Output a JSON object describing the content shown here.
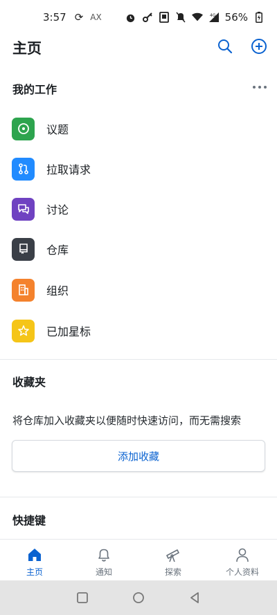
{
  "status_bar": {
    "time": "3:57",
    "indicator": "AX",
    "battery": "56%",
    "network": "4G"
  },
  "app_bar": {
    "title": "主页"
  },
  "my_work": {
    "title": "我的工作",
    "items": [
      {
        "label": "议题",
        "icon": "issue-icon",
        "color": "#2da44e"
      },
      {
        "label": "拉取请求",
        "icon": "pull-request-icon",
        "color": "#218bff"
      },
      {
        "label": "讨论",
        "icon": "discussion-icon",
        "color": "#6f42c1"
      },
      {
        "label": "仓库",
        "icon": "repository-icon",
        "color": "#3a3f47"
      },
      {
        "label": "组织",
        "icon": "organization-icon",
        "color": "#f4822d"
      },
      {
        "label": "已加星标",
        "icon": "star-icon",
        "color": "#f5c518"
      }
    ]
  },
  "favorites": {
    "title": "收藏夹",
    "description": "将仓库加入收藏夹以便随时快速访问，而无需搜索",
    "add_button": "添加收藏"
  },
  "shortcuts": {
    "title": "快捷键"
  },
  "bottom_nav": {
    "items": [
      {
        "label": "主页",
        "icon": "home-icon",
        "active": true
      },
      {
        "label": "通知",
        "icon": "bell-icon",
        "active": false
      },
      {
        "label": "探索",
        "icon": "telescope-icon",
        "active": false
      },
      {
        "label": "个人资料",
        "icon": "person-icon",
        "active": false
      }
    ]
  },
  "colors": {
    "accent": "#0a62d0",
    "text": "#1b1f23",
    "muted": "#6a737d"
  }
}
